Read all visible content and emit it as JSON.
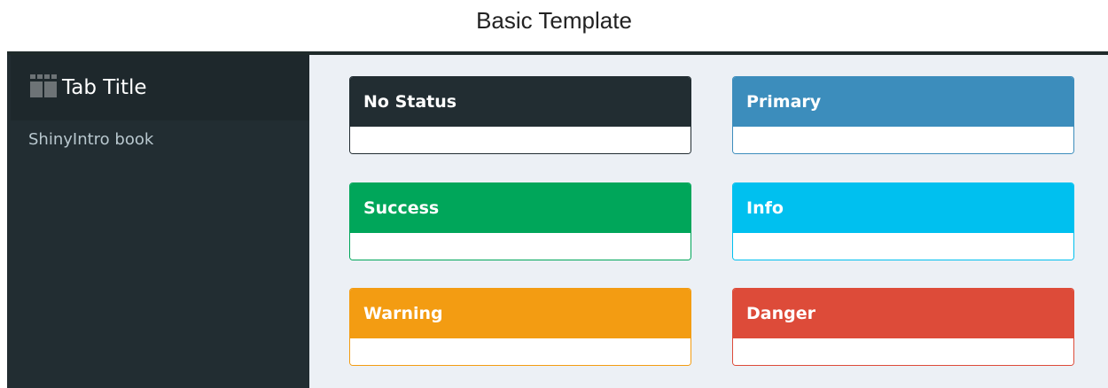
{
  "figure_title": "Basic Template",
  "header": {
    "title": "Tab Title",
    "logo_icon": "dashboard-logo-icon"
  },
  "sidebar": {
    "items": [
      {
        "label": "ShinyIntro book"
      }
    ]
  },
  "boxes": [
    {
      "title": "No Status",
      "status": "none",
      "color": "#222d32"
    },
    {
      "title": "Primary",
      "status": "primary",
      "color": "#3c8dbc"
    },
    {
      "title": "Success",
      "status": "success",
      "color": "#00a65a"
    },
    {
      "title": "Info",
      "status": "info",
      "color": "#00c0ef"
    },
    {
      "title": "Warning",
      "status": "warning",
      "color": "#f39c12"
    },
    {
      "title": "Danger",
      "status": "danger",
      "color": "#dd4b39"
    }
  ],
  "colors": {
    "sidebar_bg": "#222d32",
    "header_bg": "#1e282c",
    "content_bg": "#ecf0f5",
    "sidebar_text": "#b8c7ce"
  }
}
